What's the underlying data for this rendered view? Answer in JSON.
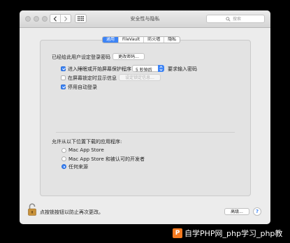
{
  "window": {
    "title": "安全性与隐私",
    "search_placeholder": "搜索"
  },
  "tabs": [
    {
      "label": "通用",
      "active": true
    },
    {
      "label": "FileVault",
      "active": false
    },
    {
      "label": "防火墙",
      "active": false
    },
    {
      "label": "隐私",
      "active": false
    }
  ],
  "general": {
    "password_label": "已经给此用户设定登录密码",
    "change_password_button": "更改密码...",
    "require_password": {
      "label": "进入睡眠或开始屏幕保护程序",
      "checked": true,
      "delay_value": "5 秒钟后",
      "suffix": "要求输入密码"
    },
    "lock_message": {
      "label": "在屏幕锁定时显示信息",
      "checked": false,
      "button": "设定锁定信息..."
    },
    "disable_auto_login": {
      "label": "停用自动登录",
      "checked": true
    }
  },
  "downloads": {
    "heading": "允许从以下位置下载的应用程序:",
    "options": [
      {
        "label": "Mac App Store",
        "selected": false
      },
      {
        "label": "Mac App Store 和被认可的开发者",
        "selected": false
      },
      {
        "label": "任何来源",
        "selected": true
      }
    ]
  },
  "footer": {
    "lock_text": "点按锁按钮以防止再次更改。",
    "advanced_button": "高级...",
    "help": "?"
  },
  "watermark": {
    "logo": "P",
    "text": "自学PHP网_php学习_php教"
  },
  "colors": {
    "accent": "#3c83f5",
    "window_bg": "#ececec",
    "outer_bg": "#000000",
    "watermark_logo": "#f47a20"
  }
}
